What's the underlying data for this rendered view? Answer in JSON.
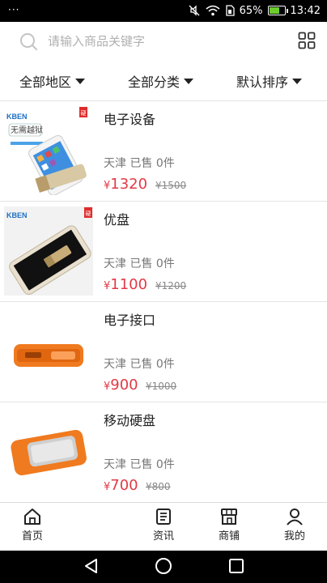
{
  "status": {
    "dots": "···",
    "battery": "65%",
    "time": "13:42",
    "battery_level": 0.65
  },
  "search": {
    "placeholder": "请输入商品关键字",
    "icon": "search-icon",
    "grid_icon": "grid-icon"
  },
  "filters": [
    {
      "label": "全部地区"
    },
    {
      "label": "全部分类"
    },
    {
      "label": "默认排序"
    }
  ],
  "products": [
    {
      "title": "电子设备",
      "location": "天津",
      "sold": "已售 0件",
      "price": "1320",
      "old_price": "¥1500",
      "image": "iphone-usb-drive"
    },
    {
      "title": "优盘",
      "location": "天津",
      "sold": "已售 0件",
      "price": "1100",
      "old_price": "¥1200",
      "image": "phone-with-drive"
    },
    {
      "title": "电子接口",
      "location": "天津",
      "sold": "已售 0件",
      "price": "900",
      "old_price": "¥1000",
      "image": "orange-hdd"
    },
    {
      "title": "移动硬盘",
      "location": "天津",
      "sold": "已售 0件",
      "price": "700",
      "old_price": "¥800",
      "image": "orange-hdd-2"
    }
  ],
  "thumb_text": {
    "brand": "KBEN",
    "tagline": "无需越狱",
    "badge": "硬"
  },
  "currency": "¥",
  "tabs": [
    {
      "label": "首页",
      "icon": "home-icon"
    },
    {
      "label": "资讯",
      "icon": "news-icon"
    },
    {
      "label": "商铺",
      "icon": "store-icon"
    },
    {
      "label": "我的",
      "icon": "user-icon"
    }
  ],
  "colors": {
    "price": "#e23a46",
    "statusbar": "#000000",
    "text": "#222222"
  }
}
